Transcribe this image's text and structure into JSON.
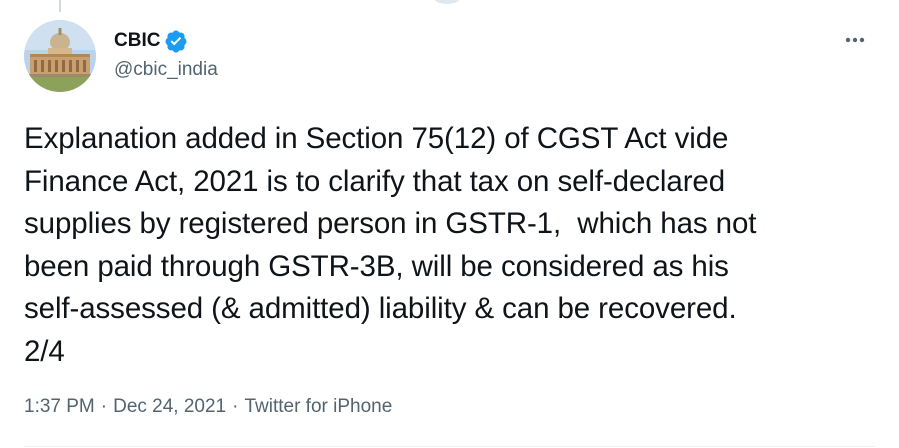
{
  "author": {
    "name": "CBIC",
    "handle": "@cbic_india",
    "verified": true,
    "avatar_icon": "building-avatar"
  },
  "tweet": {
    "text": "Explanation added in Section 75(12) of CGST Act vide\nFinance Act, 2021 is to clarify that tax on self-declared\nsupplies by registered person in GSTR-1,  which has not\nbeen paid through GSTR-3B, will be considered as his\nself-assessed (& admitted) liability & can be recovered.\n2/4"
  },
  "meta": {
    "time": "1:37 PM",
    "separator": "·",
    "date": "Dec 24, 2021",
    "source": "Twitter for iPhone"
  },
  "colors": {
    "text": "#0f1419",
    "secondary": "#536471",
    "verified": "#1d9bf0"
  },
  "icons": {
    "more": "more-horizontal-icon",
    "verified": "verified-badge-icon"
  }
}
